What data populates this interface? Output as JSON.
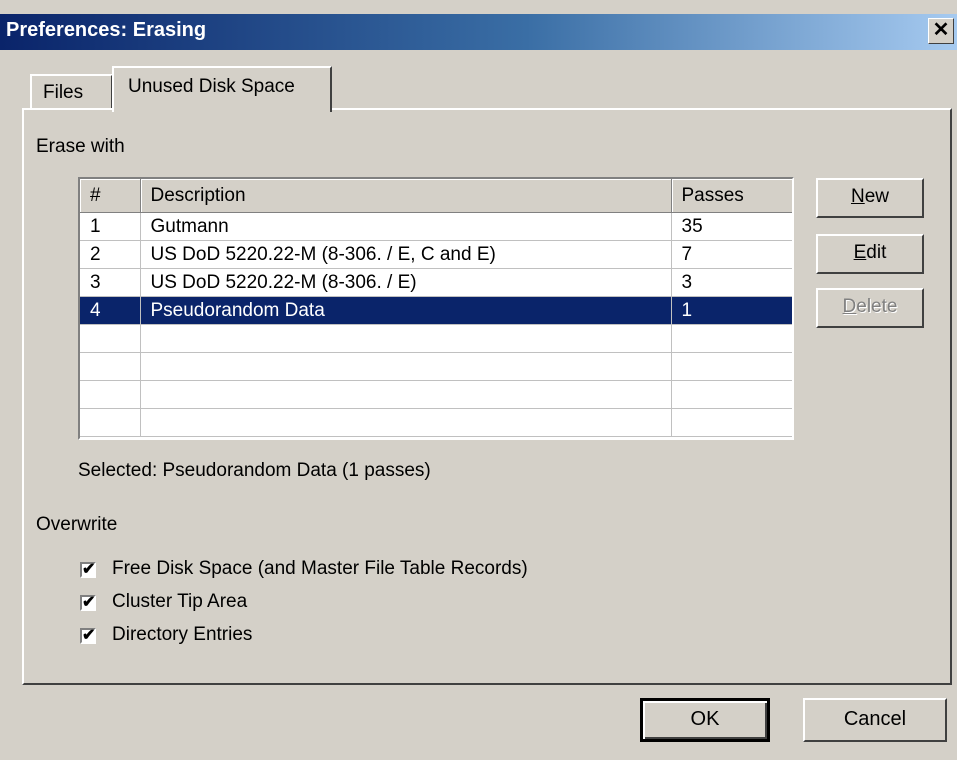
{
  "window": {
    "title": "Preferences: Erasing",
    "close_symbol": "✕"
  },
  "tabs": [
    {
      "label": "Files",
      "active": false
    },
    {
      "label": "Unused Disk Space",
      "active": true
    }
  ],
  "erase_with": {
    "heading": "Erase with",
    "columns": [
      "#",
      "Description",
      "Passes"
    ],
    "rows": [
      {
        "num": "1",
        "description": "Gutmann",
        "passes": "35"
      },
      {
        "num": "2",
        "description": "US DoD 5220.22-M (8-306. / E, C and E)",
        "passes": "7"
      },
      {
        "num": "3",
        "description": "US DoD 5220.22-M (8-306. / E)",
        "passes": "3"
      },
      {
        "num": "4",
        "description": "Pseudorandom Data",
        "passes": "1"
      }
    ],
    "selected_index": 3,
    "selected_text": "Selected: Pseudorandom Data (1 passes)"
  },
  "list_buttons": {
    "new": {
      "mnemonic": "N",
      "rest": "ew"
    },
    "edit": {
      "mnemonic": "E",
      "rest": "dit"
    },
    "delete": {
      "mnemonic": "D",
      "rest": "elete",
      "disabled": true
    }
  },
  "overwrite": {
    "heading": "Overwrite",
    "options": [
      {
        "label": "Free Disk Space (and Master File Table Records)",
        "checked": true
      },
      {
        "label": "Cluster Tip Area",
        "checked": true
      },
      {
        "label": "Directory Entries",
        "checked": true
      }
    ]
  },
  "footer": {
    "ok_label": "OK",
    "cancel_label": "Cancel"
  },
  "icons": {
    "checkmark": "✔"
  }
}
